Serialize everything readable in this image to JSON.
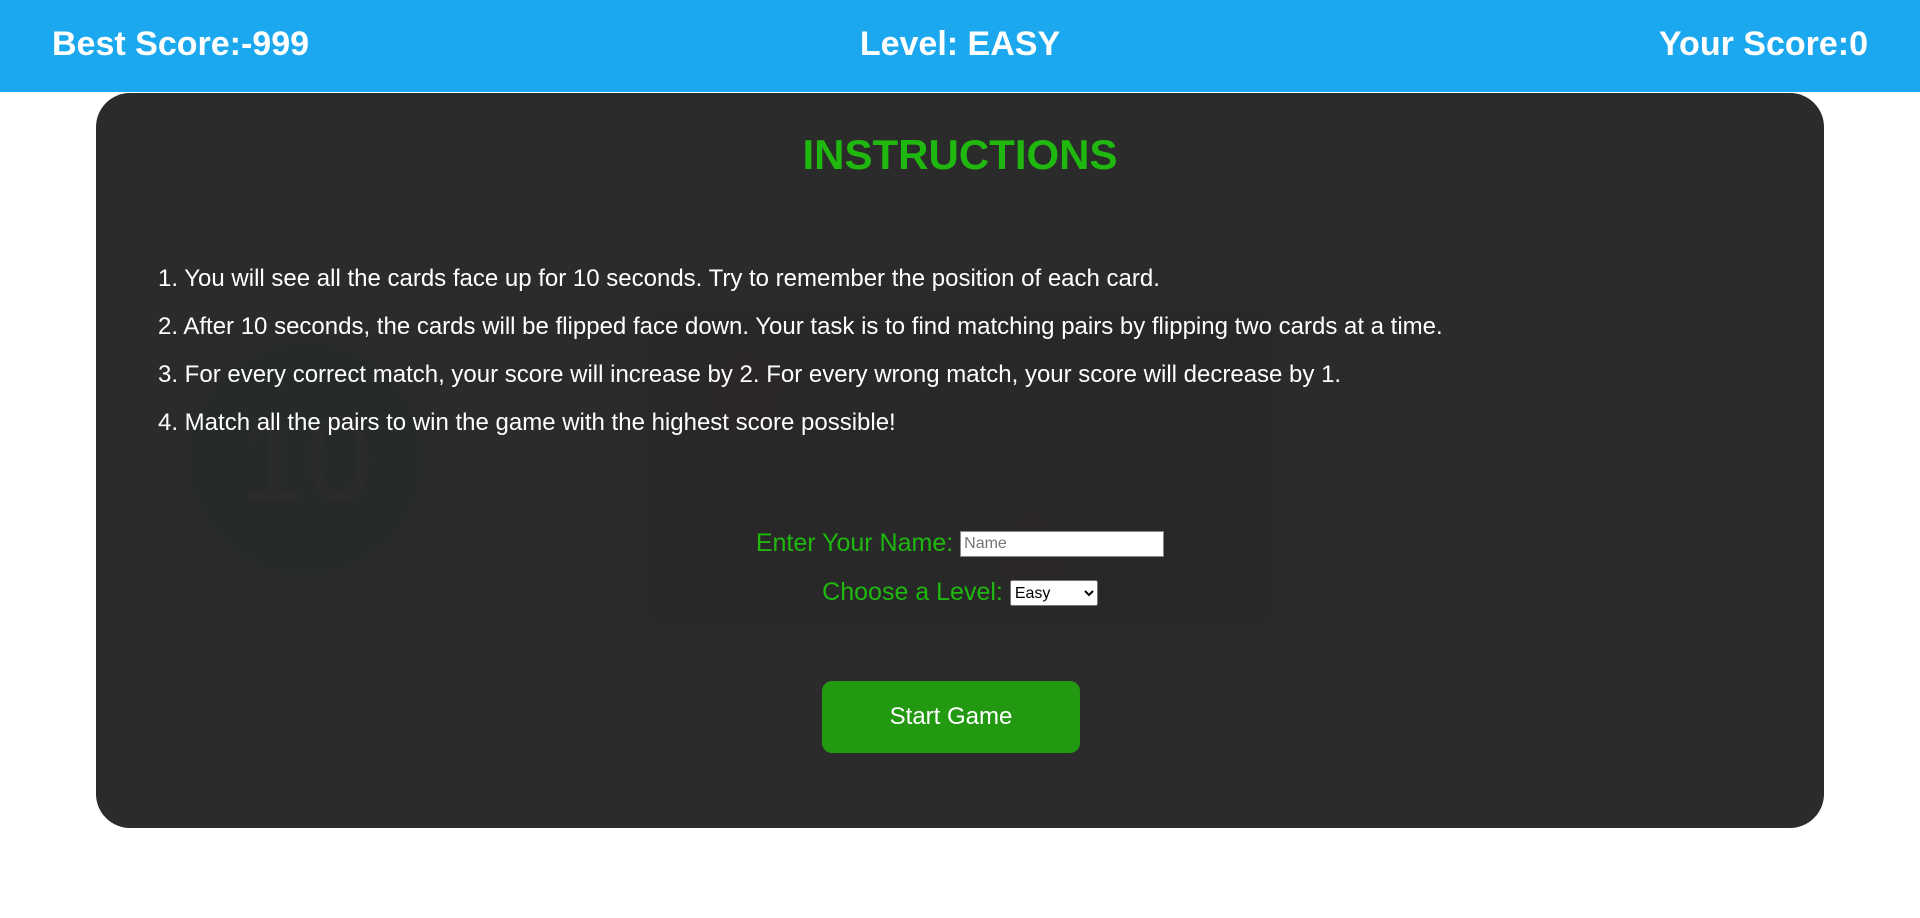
{
  "header": {
    "best_score": "Best Score:-999",
    "level": "Level: EASY",
    "your_score": "Your Score:0"
  },
  "background_game": {
    "timer": "10",
    "cards": [
      {
        "gem": "ruby-icon",
        "color": "#e0208a"
      },
      {
        "gem": "emerald-icon",
        "color": "#4fc321"
      },
      {
        "gem": "sapphire-icon",
        "color": "#6a3ce0"
      },
      {
        "gem": "emerald-icon",
        "color": "#4fc321"
      },
      {
        "gem": "pentagon-ruby-icon",
        "color": "#b0154e"
      },
      {
        "gem": "sapphire-icon",
        "color": "#6a3ce0"
      },
      {
        "gem": "ruby-icon",
        "color": "#e0208a"
      },
      {
        "gem": "pentagon-ruby-icon",
        "color": "#b0154e"
      }
    ]
  },
  "modal": {
    "title": "INSTRUCTIONS",
    "instructions": [
      "1. You will see all the cards face up for 10 seconds. Try to remember the position of each card.",
      "2. After 10 seconds, the cards will be flipped face down. Your task is to find matching pairs by flipping two cards at a time.",
      "3. For every correct match, your score will increase by 2. For every wrong match, your score will decrease by 1.",
      "4. Match all the pairs to win the game with the highest score possible!"
    ],
    "name_label": "Enter Your Name:",
    "name_placeholder": "Name",
    "level_label": "Choose a Level:",
    "level_selected": "Easy",
    "start_label": "Start Game"
  },
  "colors": {
    "header_bg": "#1ba8ee",
    "accent_green": "#1fb80f",
    "button_green": "#229911",
    "modal_bg": "#2c2c2c"
  }
}
